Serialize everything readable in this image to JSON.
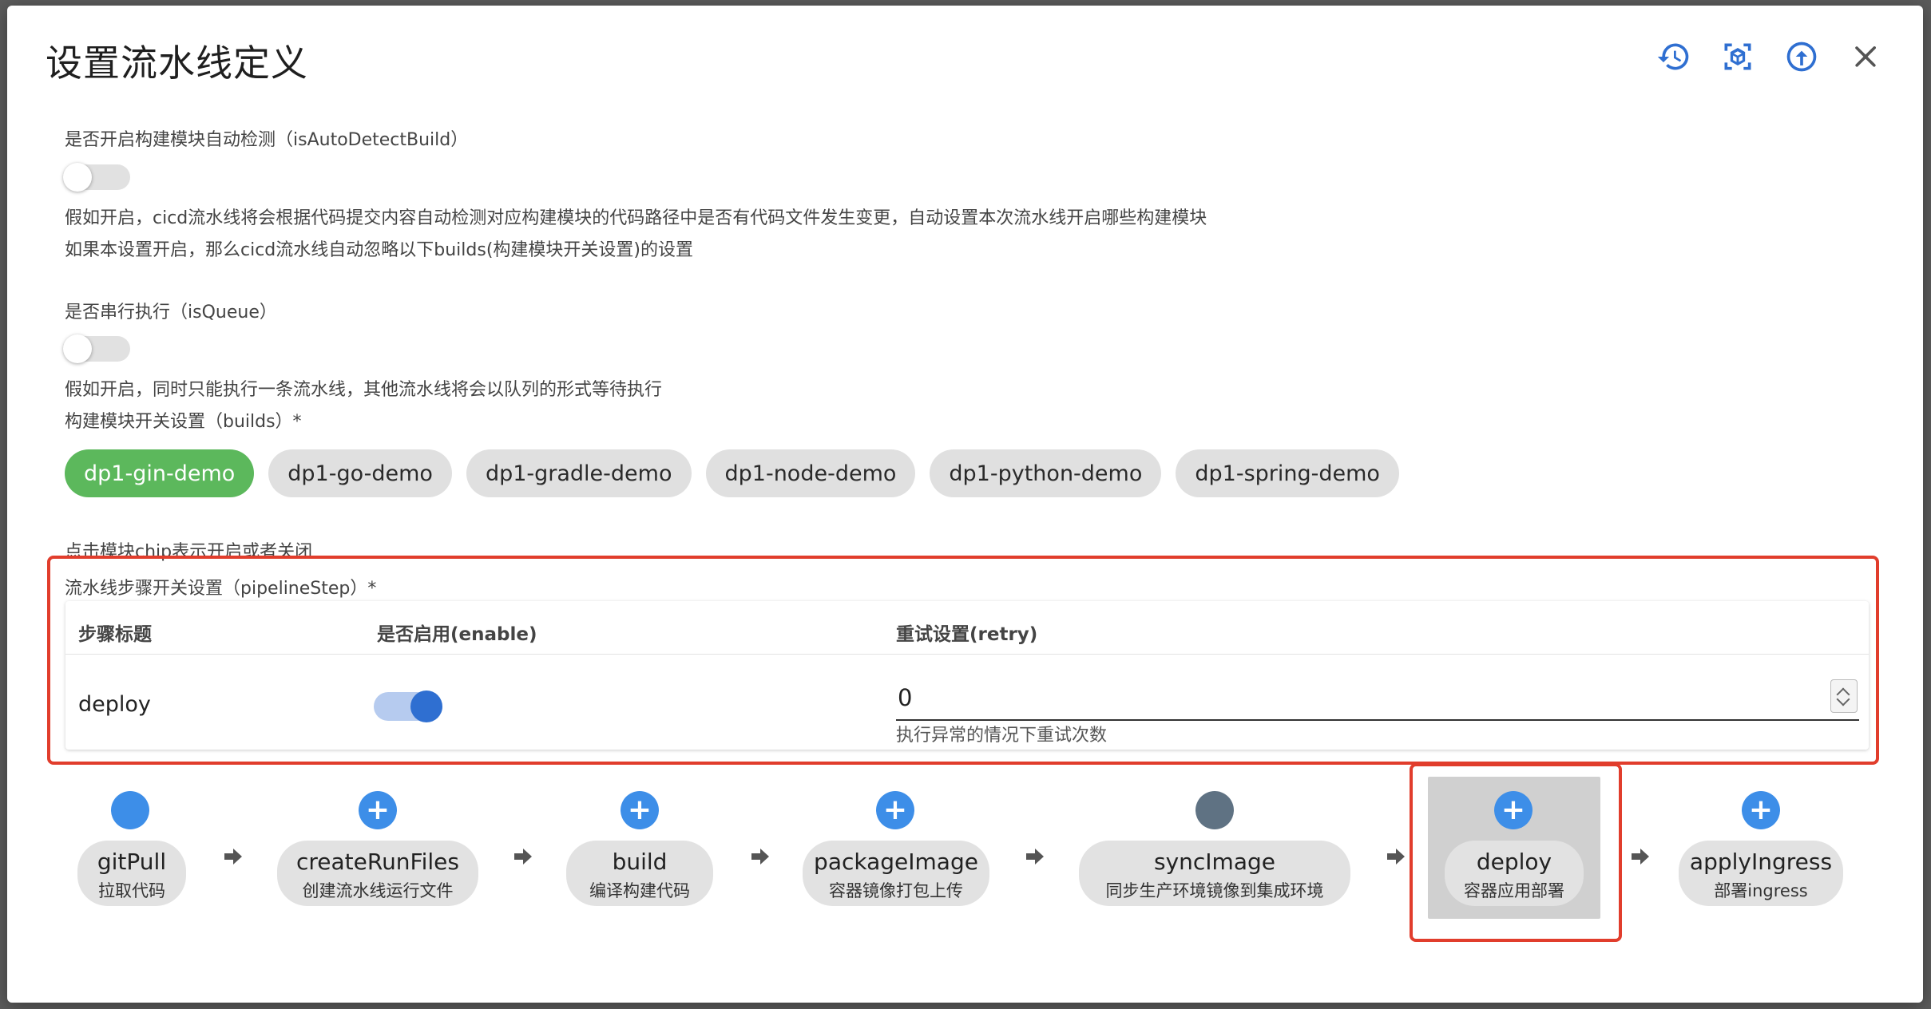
{
  "dialog": {
    "title": "设置流水线定义",
    "icons": [
      "history-icon",
      "cube-scan-icon",
      "upload-icon",
      "close-icon"
    ]
  },
  "auto_detect": {
    "label": "是否开启构建模块自动检测（isAutoDetectBuild）",
    "enabled": false,
    "desc1": "假如开启，cicd流水线将会根据代码提交内容自动检测对应构建模块的代码路径中是否有代码文件发生变更，自动设置本次流水线开启哪些构建模块",
    "desc2": "如果本设置开启，那么cicd流水线自动忽略以下builds(构建模块开关设置)的设置"
  },
  "queue": {
    "label": "是否串行执行（isQueue）",
    "enabled": false,
    "desc": "假如开启，同时只能执行一条流水线，其他流水线将会以队列的形式等待执行"
  },
  "builds": {
    "label": "构建模块开关设置（builds）*",
    "chips": [
      {
        "label": "dp1-gin-demo",
        "on": true
      },
      {
        "label": "dp1-go-demo",
        "on": false
      },
      {
        "label": "dp1-gradle-demo",
        "on": false
      },
      {
        "label": "dp1-node-demo",
        "on": false
      },
      {
        "label": "dp1-python-demo",
        "on": false
      },
      {
        "label": "dp1-spring-demo",
        "on": false
      }
    ],
    "hint": "点击模块chip表示开启或者关闭"
  },
  "pipeline_step": {
    "label": "流水线步骤开关设置（pipelineStep）*",
    "columns": [
      "步骤标题",
      "是否启用(enable)",
      "重试设置(retry)"
    ],
    "row": {
      "title": "deploy",
      "enable": true,
      "retry": "0",
      "retry_helper": "执行异常的情况下重试次数"
    }
  },
  "steps": [
    {
      "name": "gitPull",
      "desc": "拉取代码",
      "state": "done"
    },
    {
      "name": "createRunFiles",
      "desc": "创建流水线运行文件",
      "state": "add"
    },
    {
      "name": "build",
      "desc": "编译构建代码",
      "state": "add"
    },
    {
      "name": "packageImage",
      "desc": "容器镜像打包上传",
      "state": "add"
    },
    {
      "name": "syncImage",
      "desc": "同步生产环境镜像到集成环境",
      "state": "disabled"
    },
    {
      "name": "deploy",
      "desc": "容器应用部署",
      "state": "add",
      "selected": true
    },
    {
      "name": "applyIngress",
      "desc": "部署ingress",
      "state": "add"
    }
  ],
  "colors": {
    "accent": "#2f6fd1",
    "chip_on": "#5cb85c",
    "highlight": "#e13d2c"
  }
}
